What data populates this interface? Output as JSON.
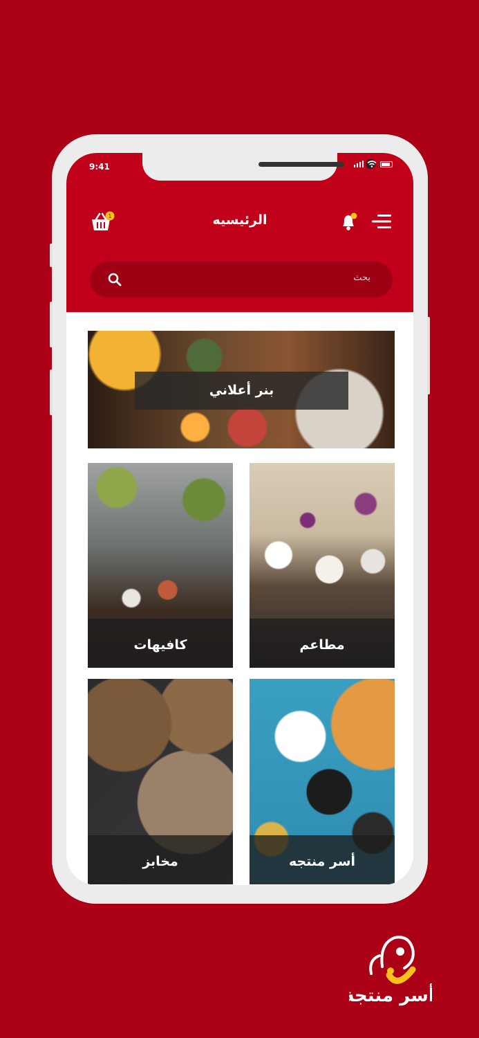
{
  "status_bar": {
    "time": "9:41"
  },
  "header": {
    "title": "الرئيسيه",
    "cart_badge": "1"
  },
  "search": {
    "placeholder": "بحث"
  },
  "banner": {
    "label": "بنر أعلاني"
  },
  "categories": [
    {
      "label": "مطاعم"
    },
    {
      "label": "كافيهات"
    },
    {
      "label": "أسر منتجه"
    },
    {
      "label": "مخابز"
    }
  ],
  "logo": {
    "text": "أسر منتجة"
  },
  "colors": {
    "background": "#ab0016",
    "header": "#c10019",
    "search": "#9e0014",
    "accent_yellow": "#f7c21b"
  }
}
